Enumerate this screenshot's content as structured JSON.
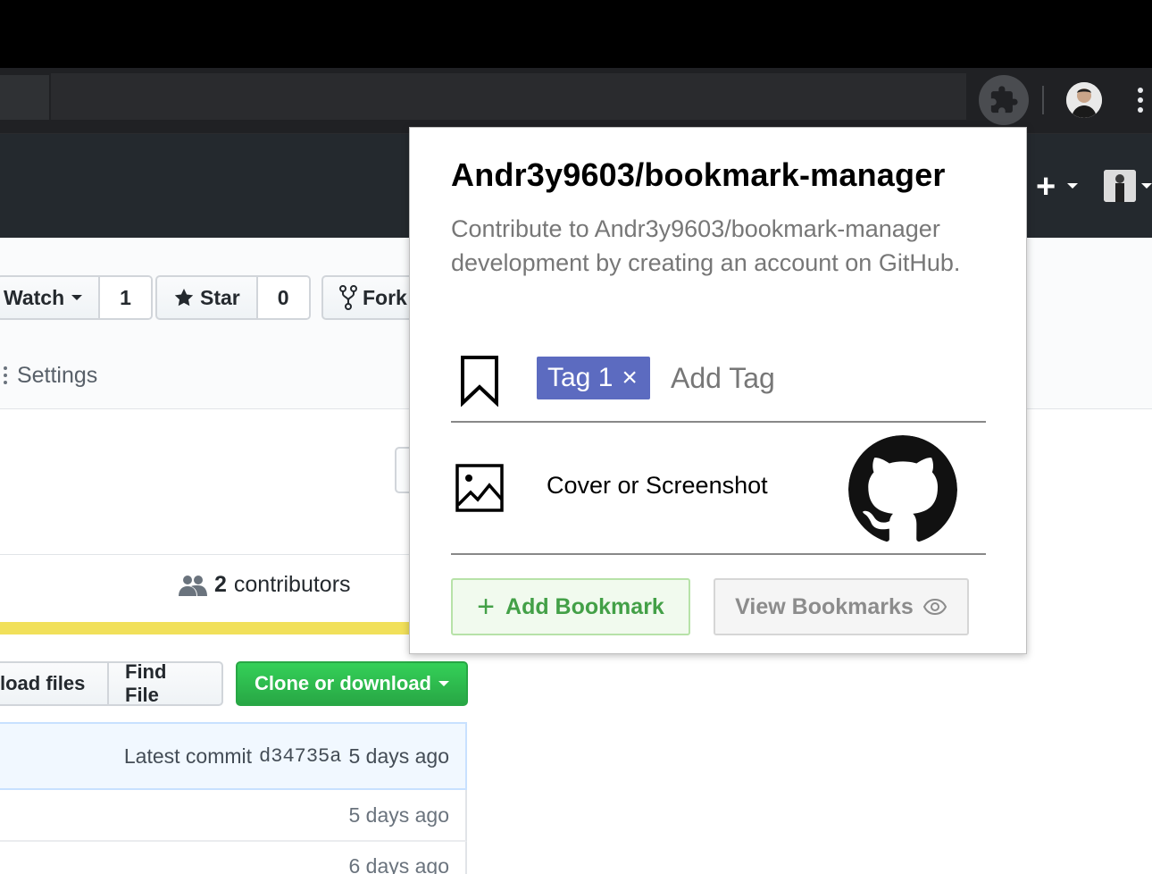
{
  "repo": {
    "watch_label": "Watch",
    "watch_count": "1",
    "star_label": "Star",
    "star_count": "0",
    "fork_label": "Fork",
    "settings_tab": "Settings",
    "contributors_count": "2",
    "contributors_label": "contributors",
    "language_bar_color": "#f1e05a",
    "upload_label": "load files",
    "find_file_label": "Find File",
    "clone_label": "Clone or download",
    "latest_commit_label": "Latest commit",
    "latest_commit_sha": "d34735a",
    "latest_commit_time": "5 days ago",
    "file_rows": [
      {
        "age": "5 days ago"
      },
      {
        "age": "6 days ago"
      }
    ]
  },
  "popup": {
    "title": "Andr3y9603/bookmark-manager",
    "description": "Contribute to Andr3y9603/bookmark-manager development by creating an account on GitHub.",
    "tag_chip": "Tag 1",
    "tag_remove_glyph": "×",
    "add_tag_placeholder": "Add Tag",
    "cover_label": "Cover or Screenshot",
    "add_bookmark_label": "Add Bookmark",
    "view_bookmarks_label": "View Bookmarks",
    "accent_tag_color": "#5c6bc0",
    "accent_add_color": "#43a047"
  },
  "icons": {
    "extension": "puzzle-icon",
    "bookmark": "bookmark-icon",
    "image": "image-icon",
    "eye": "eye-icon",
    "star": "star-icon",
    "fork": "fork-icon",
    "people": "people-icon",
    "cover": "github-octocat-icon"
  }
}
